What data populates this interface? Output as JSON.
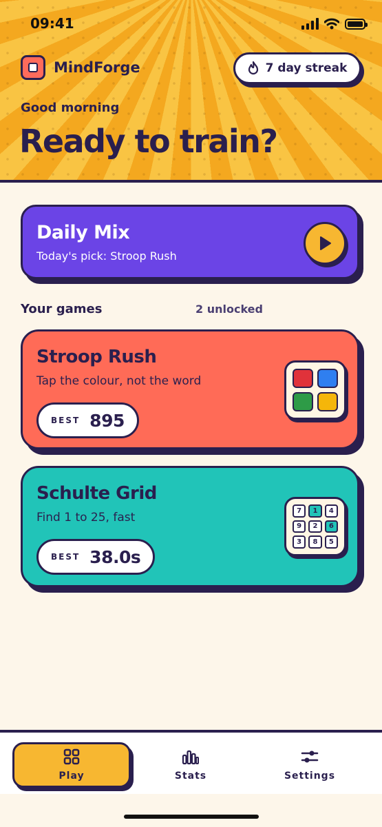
{
  "status_bar": {
    "time": "09:41"
  },
  "header": {
    "app_name": "MindForge",
    "streak_label": "7 day streak",
    "greeting": "Good morning",
    "headline": "Ready to train?"
  },
  "daily_mix": {
    "title": "Daily Mix",
    "subtitle": "Today's pick: Stroop Rush"
  },
  "games_section": {
    "title": "Your games",
    "unlocked_label": "2 unlocked"
  },
  "games": [
    {
      "title": "Stroop Rush",
      "description": "Tap the colour, not the word",
      "best_label": "BEST",
      "best_value": "895",
      "tile_colors": [
        "#e0323a",
        "#2f7ff0",
        "#2e9b47",
        "#f5b60a"
      ]
    },
    {
      "title": "Schulte Grid",
      "description": "Find 1 to 25, fast",
      "best_label": "BEST",
      "best_value": "38.0s",
      "grid_numbers": [
        "7",
        "1",
        "4",
        "9",
        "2",
        "6",
        "3",
        "8",
        "5"
      ]
    }
  ],
  "bottom_nav": {
    "items": [
      {
        "label": "Play",
        "icon": "grid-icon",
        "active": true
      },
      {
        "label": "Stats",
        "icon": "bar-chart-icon",
        "active": false
      },
      {
        "label": "Settings",
        "icon": "sliders-icon",
        "active": false
      }
    ]
  },
  "colors": {
    "accent_yellow": "#f7b731",
    "ink": "#2a1f4e",
    "purple": "#6b44e6",
    "coral": "#ff6b57",
    "teal": "#21c4b8",
    "cream": "#fdf6ea"
  }
}
